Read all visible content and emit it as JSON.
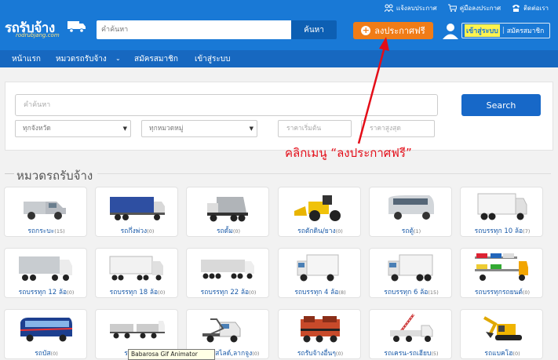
{
  "header": {
    "logo_text": "รถรับจ้าง",
    "logo_sub": "rodrubjang.com",
    "search_placeholder": "คำค้นหา",
    "search_button": "ค้นหา",
    "top_links": [
      "แจ้งลบประกาศ",
      "คู่มือลงประกาศ",
      "ติดต่อเรา"
    ],
    "post_button": "ลงประกาศฟรี",
    "login": "เข้าสู่ระบบ",
    "register": "สมัครสมาชิก"
  },
  "nav": [
    "หน้าแรก",
    "หมวดรถรับจ้าง",
    "สมัครสมาชิก",
    "เข้าสู่ระบบ"
  ],
  "search_panel": {
    "keyword_placeholder": "คำค้นหา",
    "province": "ทุกจังหวัด",
    "category": "ทุกหมวดหมู่",
    "price_min": "ราคาเริ่มต้น",
    "price_max": "ราคาสูงสุด",
    "button": "Search"
  },
  "annotation": "คลิกเมนู “ลงประกาศฟรี”",
  "section_title": "หมวดรถรับจ้าง",
  "categories": [
    {
      "label": "รถกระบะ",
      "count": "(15)",
      "icon": "pickup-truck-icon"
    },
    {
      "label": "รถกึ่งพ่วง",
      "count": "(0)",
      "icon": "semi-trailer-icon"
    },
    {
      "label": "รถดั้ม",
      "count": "(0)",
      "icon": "dump-truck-icon"
    },
    {
      "label": "รถตักดิน/ยาง",
      "count": "(0)",
      "icon": "wheel-loader-icon"
    },
    {
      "label": "รถตู้",
      "count": "(1)",
      "icon": "van-icon"
    },
    {
      "label": "รถบรรทุก 10 ล้อ",
      "count": "(7)",
      "icon": "ten-wheel-truck-icon"
    },
    {
      "label": "รถบรรทุก 12 ล้อ",
      "count": "(0)",
      "icon": "twelve-wheel-truck-icon"
    },
    {
      "label": "รถบรรทุก 18 ล้อ",
      "count": "(0)",
      "icon": "eighteen-wheel-truck-icon"
    },
    {
      "label": "รถบรรทุก 22 ล้อ",
      "count": "(0)",
      "icon": "twentytwo-wheel-truck-icon"
    },
    {
      "label": "รถบรรทุก 4 ล้อ",
      "count": "(8)",
      "icon": "four-wheel-truck-icon"
    },
    {
      "label": "รถบรรทุก 6 ล้อ",
      "count": "(15)",
      "icon": "six-wheel-truck-icon"
    },
    {
      "label": "รถบรรทุกรถยนต์",
      "count": "(0)",
      "icon": "car-carrier-icon"
    },
    {
      "label": "รถบัส",
      "count": "(0)",
      "icon": "bus-icon"
    },
    {
      "label": "รถพ่วง",
      "count": "(0)",
      "icon": "trailer-icon"
    },
    {
      "label": "รถยก,สไลด์,ลากจูง",
      "count": "(0)",
      "icon": "tow-truck-icon"
    },
    {
      "label": "รถรับจ้างอื่นๆ",
      "count": "(0)",
      "icon": "other-vehicle-icon"
    },
    {
      "label": "รถเครน-รถเฮียบ",
      "count": "(5)",
      "icon": "crane-truck-icon"
    },
    {
      "label": "รถแบคโฮ",
      "count": "(0)",
      "icon": "excavator-icon"
    }
  ],
  "tooltip": "Babarosa Gif Animator",
  "colors": {
    "header": "#1979d6",
    "nav": "#1768c0",
    "post": "#f07c17",
    "annotation": "#e40d18"
  }
}
